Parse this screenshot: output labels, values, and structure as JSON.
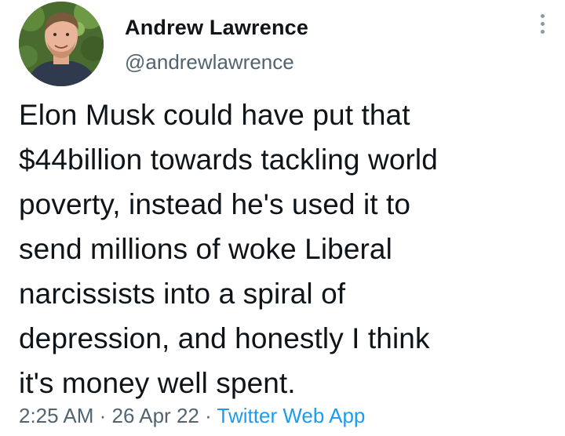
{
  "tweet": {
    "author": {
      "display_name": "Andrew Lawrence",
      "handle": "@andrewlawrence"
    },
    "text": "Elon Musk could have put that\n$44billion towards tackling world\npoverty, instead he's used it to\nsend millions of woke Liberal\nnarcissists into a spiral of\ndepression, and honestly I think\nit's money well spent.",
    "time": "2:25 AM",
    "separator": "·",
    "date": "26 Apr 22",
    "source": "Twitter Web App"
  },
  "icons": {
    "more": "more-vertical-icon"
  },
  "colors": {
    "text_primary": "#0f1419",
    "text_secondary": "#536471",
    "accent": "#1d9bf0"
  }
}
